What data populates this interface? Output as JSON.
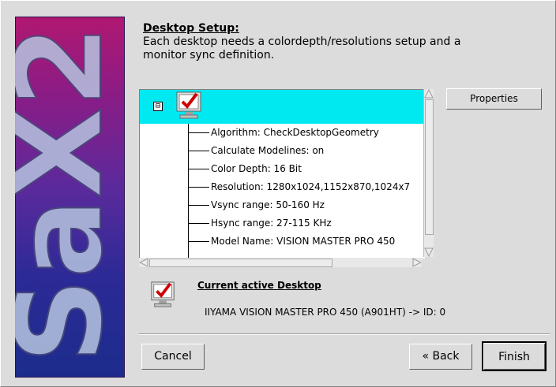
{
  "window": {
    "brand_logo_text": "SaX2"
  },
  "header": {
    "title": "Desktop Setup:",
    "description": "Each desktop needs a colordepth/resolutions setup and a monitor sync definition."
  },
  "tree": {
    "root_icon": "monitor-check-icon",
    "expander_symbol": "⊟",
    "items": [
      {
        "label": "Algorithm: CheckDesktopGeometry"
      },
      {
        "label": "Calculate Modelines: on"
      },
      {
        "label": "Color Depth: 16 Bit"
      },
      {
        "label": "Resolution: 1280x1024,1152x870,1024x7"
      },
      {
        "label": "Vsync range: 50-160 Hz"
      },
      {
        "label": "Hsync range: 27-115 KHz"
      },
      {
        "label": "Model Name: VISION MASTER PRO 450"
      }
    ]
  },
  "buttons": {
    "properties": "Properties",
    "cancel": "Cancel",
    "back": "« Back",
    "finish": "Finish"
  },
  "active_desktop": {
    "icon": "monitor-check-icon",
    "title": "Current active Desktop",
    "description": "IIYAMA VISION MASTER PRO 450 (A901HT) -> ID: 0"
  },
  "colors": {
    "selection": "#00e8f0",
    "banner_top": "#b01870",
    "banner_bottom": "#1c2c8c"
  }
}
